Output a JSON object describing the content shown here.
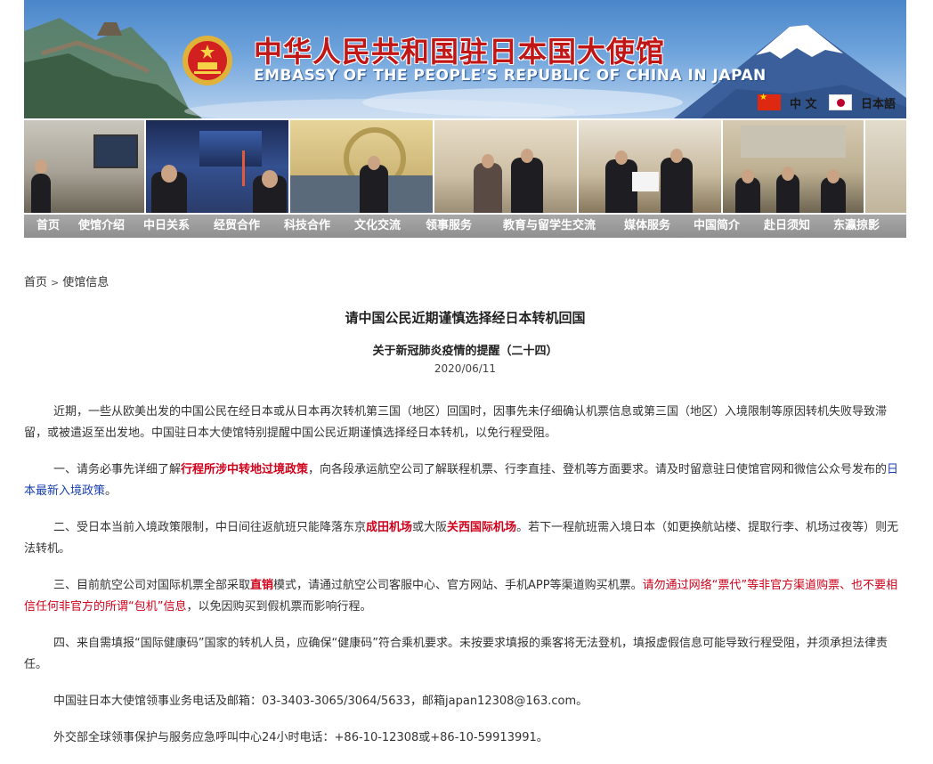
{
  "header": {
    "title_cn": "中华人民共和国驻日本国大使馆",
    "title_en": "EMBASSY OF THE PEOPLE'S REPUBLIC OF CHINA IN JAPAN",
    "lang_zh": "中 文",
    "lang_ja": "日本語",
    "colors": {
      "title": "#c01616",
      "nav_bg": "#999999",
      "link_red": "#d0021b",
      "link_blue": "#1a3fb0"
    }
  },
  "nav": [
    "首页",
    "使馆介绍",
    "中日关系",
    "经贸合作",
    "科技合作",
    "文化交流",
    "领事服务",
    "教育与留学生交流",
    "媒体服务",
    "中国简介",
    "赴日须知",
    "东瀛掠影"
  ],
  "breadcrumb": {
    "home": "首页",
    "sep": ">",
    "current": "使馆信息"
  },
  "article": {
    "title": "请中国公民近期谨慎选择经日本转机回国",
    "subtitle": "关于新冠肺炎疫情的提醒（二十四）",
    "date": "2020/06/11",
    "p1": "近期，一些从欧美出发的中国公民在经日本或从日本再次转机第三国（地区）回国时，因事先未仔细确认机票信息或第三国（地区）入境限制等原因转机失败导致滞留，或被遣返至出发地。中国驻日本大使馆特别提醒中国公民近期谨慎选择经日本转机，以免行程受阻。",
    "p2": {
      "a": "一、请务必事先详细了解",
      "link1": "行程所涉中转地过境政策",
      "b": "，向各段承运航空公司了解联程机票、行李直挂、登机等方面要求。请及时留意驻日使馆官网和微信公众号发布的",
      "link2": "日本最新入境政策",
      "c": "。"
    },
    "p3": {
      "a": "二、受日本当前入境政策限制，中日间往返航班只能降落东京",
      "k1": "成田机场",
      "b": "或大阪",
      "k2": "关西国际机场",
      "c": "。若下一程航班需入境日本（如更换航站楼、提取行李、机场过夜等）则无法转机。"
    },
    "p4": {
      "a": "三、目前航空公司对国际机票全部采取",
      "k1": "直销",
      "b": "模式，请通过航空公司客服中心、官方网站、手机APP等渠道购买机票。",
      "warn": "请勿通过网络“票代”等非官方渠道购票、也不要相信任何非官方的所谓“包机”信息",
      "c": "，以免因购买到假机票而影响行程。"
    },
    "p5": "四、来自需填报“国际健康码”国家的转机人员，应确保“健康码”符合乘机要求。未按要求填报的乘客将无法登机，填报虚假信息可能导致行程受阻，并须承担法律责任。",
    "p6": "中国驻日本大使馆领事业务电话及邮箱：03-3403-3065/3064/5633，邮箱japan12308@163.com。",
    "p7": "外交部全球领事保护与服务应急呼叫中心24小时电话：+86-10-12308或+86-10-59913991。"
  }
}
